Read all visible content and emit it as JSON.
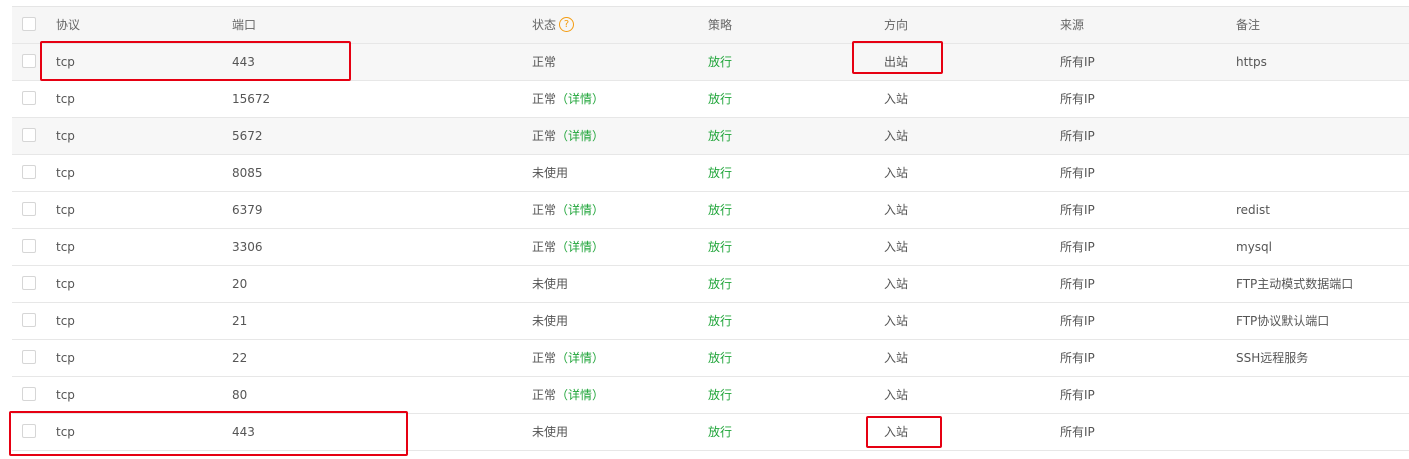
{
  "header": {
    "protocol": "协议",
    "port": "端口",
    "status": "状态",
    "status_help_icon": "?",
    "policy": "策略",
    "direction": "方向",
    "source": "来源",
    "note": "备注"
  },
  "rows": [
    {
      "protocol": "tcp",
      "port": "443",
      "status": "正常",
      "detail": "",
      "policy": "放行",
      "direction": "出站",
      "source": "所有IP",
      "note": "https"
    },
    {
      "protocol": "tcp",
      "port": "15672",
      "status": "正常",
      "detail": "（详情）",
      "policy": "放行",
      "direction": "入站",
      "source": "所有IP",
      "note": ""
    },
    {
      "protocol": "tcp",
      "port": "5672",
      "status": "正常",
      "detail": "（详情）",
      "policy": "放行",
      "direction": "入站",
      "source": "所有IP",
      "note": ""
    },
    {
      "protocol": "tcp",
      "port": "8085",
      "status": "未使用",
      "detail": "",
      "policy": "放行",
      "direction": "入站",
      "source": "所有IP",
      "note": ""
    },
    {
      "protocol": "tcp",
      "port": "6379",
      "status": "正常",
      "detail": "（详情）",
      "policy": "放行",
      "direction": "入站",
      "source": "所有IP",
      "note": "redist"
    },
    {
      "protocol": "tcp",
      "port": "3306",
      "status": "正常",
      "detail": "（详情）",
      "policy": "放行",
      "direction": "入站",
      "source": "所有IP",
      "note": "mysql"
    },
    {
      "protocol": "tcp",
      "port": "20",
      "status": "未使用",
      "detail": "",
      "policy": "放行",
      "direction": "入站",
      "source": "所有IP",
      "note": "FTP主动模式数据端口"
    },
    {
      "protocol": "tcp",
      "port": "21",
      "status": "未使用",
      "detail": "",
      "policy": "放行",
      "direction": "入站",
      "source": "所有IP",
      "note": "FTP协议默认端口"
    },
    {
      "protocol": "tcp",
      "port": "22",
      "status": "正常",
      "detail": "（详情）",
      "policy": "放行",
      "direction": "入站",
      "source": "所有IP",
      "note": "SSH远程服务"
    },
    {
      "protocol": "tcp",
      "port": "80",
      "status": "正常",
      "detail": "（详情）",
      "policy": "放行",
      "direction": "入站",
      "source": "所有IP",
      "note": ""
    },
    {
      "protocol": "tcp",
      "port": "443",
      "status": "未使用",
      "detail": "",
      "policy": "放行",
      "direction": "入站",
      "source": "所有IP",
      "note": ""
    }
  ],
  "colors": {
    "accent_green": "#20a53a",
    "highlight_red": "#e60012",
    "help_orange": "#f39c12"
  }
}
